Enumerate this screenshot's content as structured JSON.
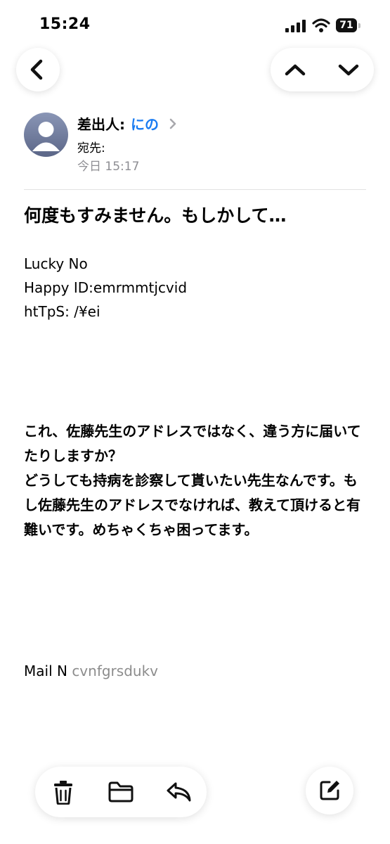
{
  "status_bar": {
    "time": "15:24",
    "battery": "71"
  },
  "header": {
    "from_label": "差出人:",
    "from_name": "にの",
    "to_label": "宛先:",
    "date": "今日 15:17"
  },
  "message": {
    "subject": "何度もすみません。もしかして…",
    "lucky_line": "Lucky No",
    "happy_line": "Happy ID:emrmmtjcvid",
    "https_line": "htTpS: /¥ei",
    "body_paragraphs": [
      "これ、佐藤先生のアドレスではなく、違う方に届いてたりしますか？",
      "どうしても持病を診察して貰いたい先生なんです。もし佐藤先生のアドレスでなければ、教えて頂けると有難いです。めちゃくちゃ困ってます。"
    ],
    "mail_line": "Mail N",
    "mail_suffix": "cvnfgrsdukv"
  },
  "icons": {
    "back": "chevron-left-icon",
    "prev": "chevron-up-icon",
    "next": "chevron-down-icon",
    "trash": "trash-icon",
    "folder": "folder-icon",
    "reply": "reply-icon",
    "compose": "compose-icon"
  },
  "colors": {
    "accent": "#1a7cf2",
    "secondary_text": "#8e8e93"
  }
}
